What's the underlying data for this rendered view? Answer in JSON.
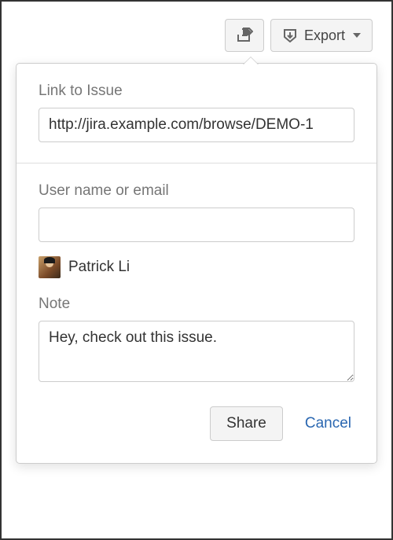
{
  "toolbar": {
    "export_label": "Export"
  },
  "popup": {
    "link_label": "Link to Issue",
    "link_value": "http://jira.example.com/browse/DEMO-1",
    "user_label": "User name or email",
    "user_value": "",
    "selected_user": "Patrick Li",
    "note_label": "Note",
    "note_value": "Hey, check out this issue.",
    "share_label": "Share",
    "cancel_label": "Cancel"
  }
}
